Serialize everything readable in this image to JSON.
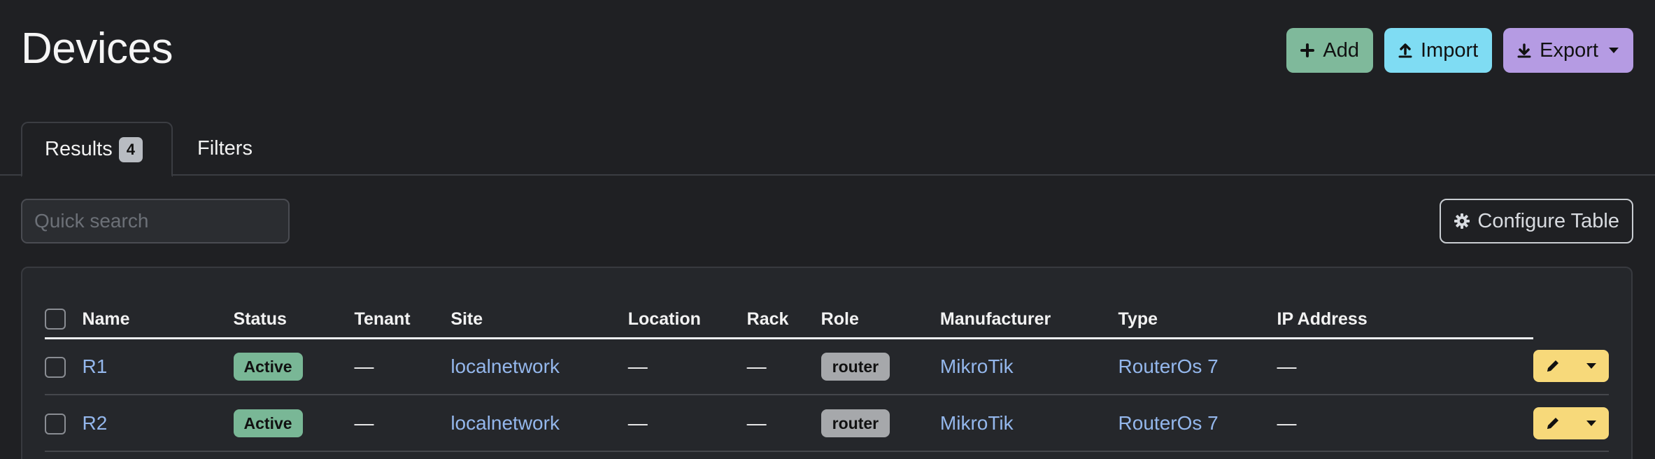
{
  "page": {
    "title": "Devices"
  },
  "header": {
    "add_label": "Add",
    "import_label": "Import",
    "export_label": "Export"
  },
  "tabs": [
    {
      "label": "Results",
      "count": "4"
    },
    {
      "label": "Filters"
    }
  ],
  "search": {
    "placeholder": "Quick search",
    "value": ""
  },
  "configure_table_label": "Configure Table",
  "table": {
    "columns": [
      "Name",
      "Status",
      "Tenant",
      "Site",
      "Location",
      "Rack",
      "Role",
      "Manufacturer",
      "Type",
      "IP Address"
    ],
    "rows": [
      {
        "name": "R1",
        "status": "Active",
        "tenant": "—",
        "site": "localnetwork",
        "location": "—",
        "rack": "—",
        "role": "router",
        "manufacturer": "MikroTik",
        "type": "RouterOs 7",
        "ip_address": "—"
      },
      {
        "name": "R2",
        "status": "Active",
        "tenant": "—",
        "site": "localnetwork",
        "location": "—",
        "rack": "—",
        "role": "router",
        "manufacturer": "MikroTik",
        "type": "RouterOs 7",
        "ip_address": "—"
      }
    ]
  },
  "colors": {
    "background": "#1f2023",
    "add_button": "#7fb99b",
    "import_button": "#7fdcf3",
    "export_button": "#b59be3",
    "status_active": "#79b796",
    "role_badge": "#a6a8ab",
    "edit_button": "#f7d97a",
    "link": "#94b7ec"
  },
  "icons": {
    "add": "plus-icon",
    "import": "upload-icon",
    "export": "download-icon",
    "export_menu": "caret-down-icon",
    "configure": "gear-icon",
    "edit": "pencil-icon",
    "row_menu": "caret-down-icon"
  }
}
